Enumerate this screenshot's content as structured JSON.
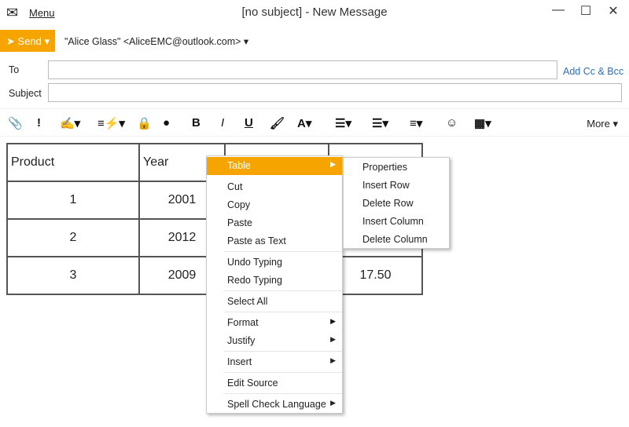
{
  "window": {
    "title": "[no subject] - New Message",
    "menu_label": "Menu",
    "minimize": "—",
    "maximize": "☐",
    "close": "✕"
  },
  "header": {
    "send_label": "Send",
    "from": "\"Alice Glass\" <AliceEMC@outlook.com>",
    "to_label": "To",
    "subject_label": "Subject",
    "to_value": "",
    "subject_value": "",
    "add_cc_bcc": "Add Cc & Bcc"
  },
  "toolbar": {
    "more_label": "More",
    "icons": [
      "paperclip-icon",
      "priority-icon",
      "signature-icon",
      "quick-text-icon",
      "lock-icon",
      "badge-icon",
      "bold-icon",
      "italic-icon",
      "underline-icon",
      "brush-icon",
      "font-color-icon",
      "bullet-list-icon",
      "numbered-list-icon",
      "align-icon",
      "emoji-icon",
      "table-icon"
    ]
  },
  "table": {
    "rows": [
      [
        "Product",
        "Year",
        "",
        ""
      ],
      [
        "1",
        "2001",
        "",
        ""
      ],
      [
        "2",
        "2012",
        "",
        ""
      ],
      [
        "3",
        "2009",
        "",
        "17.50"
      ]
    ]
  },
  "context_menu": {
    "items": [
      "Table",
      "Cut",
      "Copy",
      "Paste",
      "Paste as Text",
      "Undo Typing",
      "Redo Typing",
      "Select All",
      "Format",
      "Justify",
      "Insert",
      "Edit Source",
      "Spell Check Language"
    ]
  },
  "submenu": {
    "items": [
      "Properties",
      "Insert Row",
      "Delete Row",
      "Insert Column",
      "Delete Column"
    ]
  },
  "colors": {
    "accent": "#f5a400",
    "link": "#2a6ebb"
  }
}
